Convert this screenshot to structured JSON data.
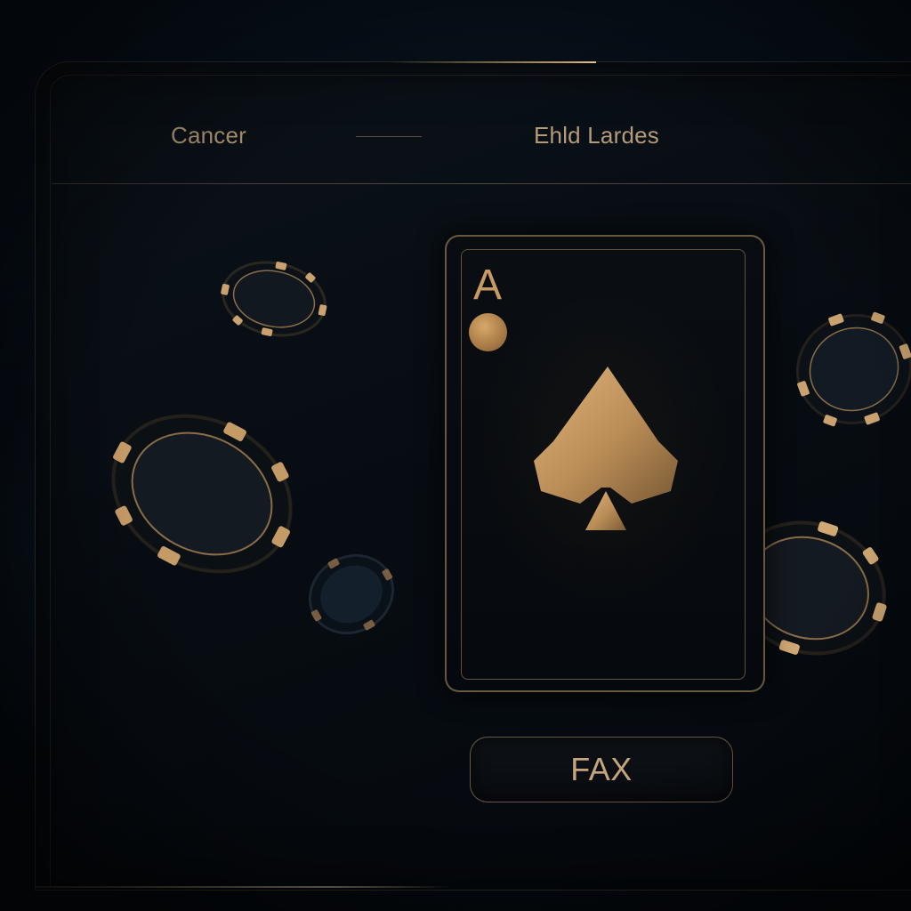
{
  "header": {
    "tabs": [
      {
        "label": "Cancer"
      },
      {
        "label": "Ehld Lardes"
      }
    ]
  },
  "card": {
    "rank": "A",
    "suit_icon": "spade-icon",
    "pip_icon": "circle-pip-icon"
  },
  "actions": {
    "primary_label": "FAX"
  },
  "chips": {
    "count": 5,
    "icon": "poker-chip-icon"
  },
  "colors": {
    "accent_gold": "#c79a62",
    "text_gold": "#b59a78",
    "background": "#060a10",
    "border_gold": "#aa8c5f"
  }
}
